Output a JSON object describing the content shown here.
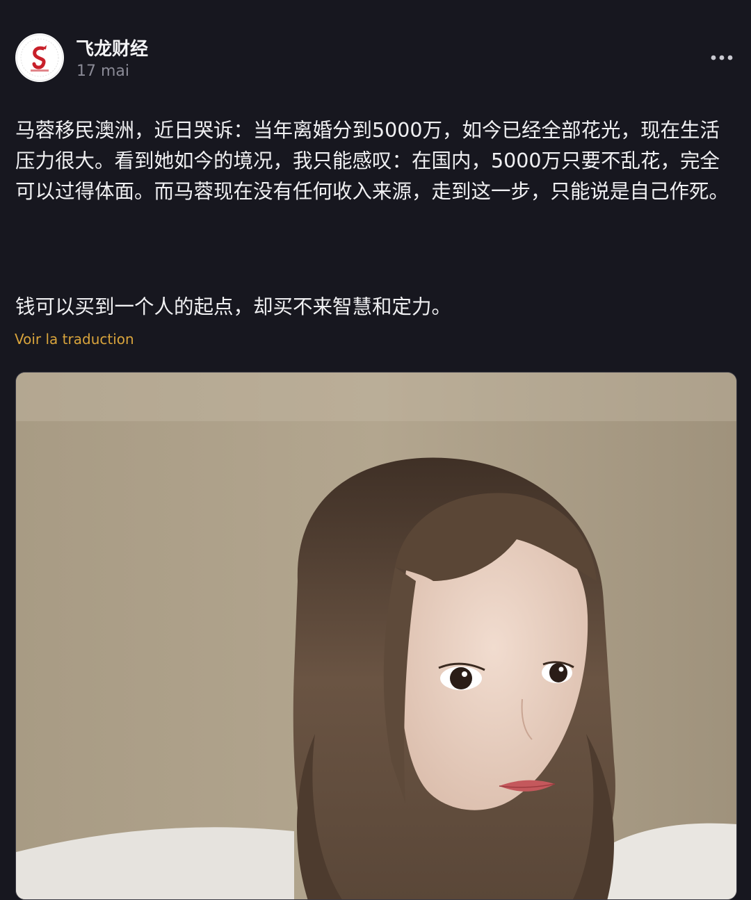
{
  "post": {
    "author": "飞龙财经",
    "date": "17 mai",
    "paragraphs": [
      "马蓉移民澳洲，近日哭诉：当年离婚分到5000万，如今已经全部花光，现在生活压力很大。看到她如今的境况，我只能感叹：在国内，5000万只要不乱花，完全可以过得体面。而马蓉现在没有任何收入来源，走到这一步，只能说是自己作死。",
      "钱可以买到一个人的起点，却买不来智慧和定力。"
    ],
    "translate_label": "Voir la traduction"
  },
  "icons": {
    "menu": "more-horizontal-icon",
    "avatar": "dragon-logo"
  },
  "colors": {
    "background": "#17171f",
    "link": "#d9a43c",
    "muted": "#8a8a96",
    "logo_red": "#c8202a"
  }
}
